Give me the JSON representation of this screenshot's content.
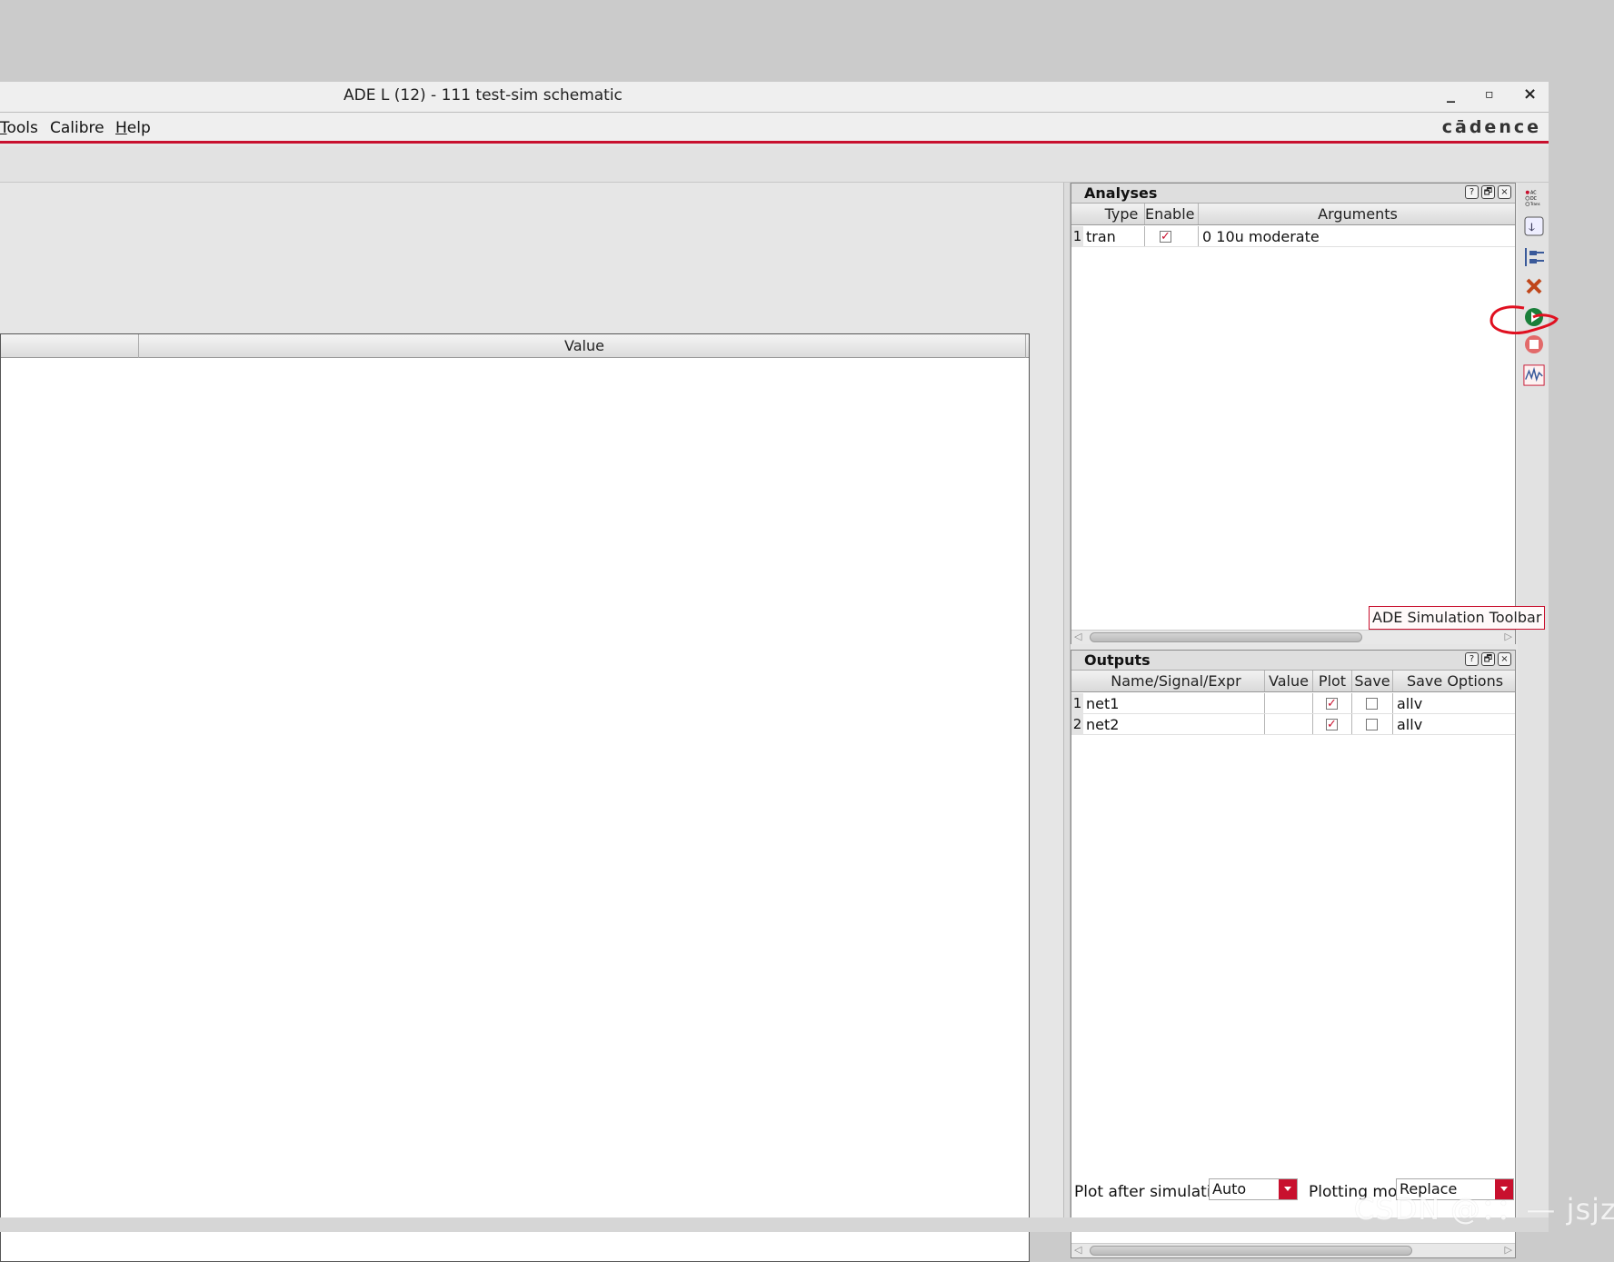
{
  "window": {
    "title": "ADE L (12) - 111 test-sim schematic",
    "minimize": "_",
    "maximize": "▫",
    "close": "×"
  },
  "menubar": {
    "items": [
      {
        "label": "Tools",
        "mnemonic": "T",
        "rest": "ools"
      },
      {
        "label": "Calibre"
      },
      {
        "label": "Help",
        "mnemonic": "H",
        "rest": "elp"
      }
    ],
    "logo": "cādence"
  },
  "design_vars_table": {
    "columns": [
      "",
      "Value"
    ]
  },
  "analyses": {
    "title": "Analyses",
    "columns": [
      "Type",
      "Enable",
      "Arguments"
    ],
    "rows": [
      {
        "num": "1",
        "type": "tran",
        "enabled": true,
        "arguments": "0 10u moderate"
      }
    ]
  },
  "outputs": {
    "title": "Outputs",
    "columns": [
      "Name/Signal/Expr",
      "Value",
      "Plot",
      "Save",
      "Save Options"
    ],
    "rows": [
      {
        "num": "1",
        "name": "net1",
        "value": "",
        "plot": true,
        "save": false,
        "save_options": "allv"
      },
      {
        "num": "2",
        "name": "net2",
        "value": "",
        "plot": true,
        "save": false,
        "save_options": "allv"
      }
    ]
  },
  "dock_buttons": {
    "help": "?",
    "float": "🗗",
    "close": "×"
  },
  "tooltip": "ADE Simulation Toolbar",
  "bottom": {
    "plot_after_label": "Plot after simulatio",
    "plot_after_value": "Auto",
    "plotting_mode_label": "Plotting mod",
    "plotting_mode_value": "Replace"
  },
  "toolbar_icons": [
    "ac-dc-trans-icon",
    "setup-icon",
    "netlist-icon",
    "delete-icon",
    "run-simulation-icon",
    "stop-simulation-icon",
    "waveform-icon"
  ],
  "watermark": "CSDN @：：— jsjz",
  "colors": {
    "accent": "#c8102e",
    "run": "#1a7f3a"
  }
}
